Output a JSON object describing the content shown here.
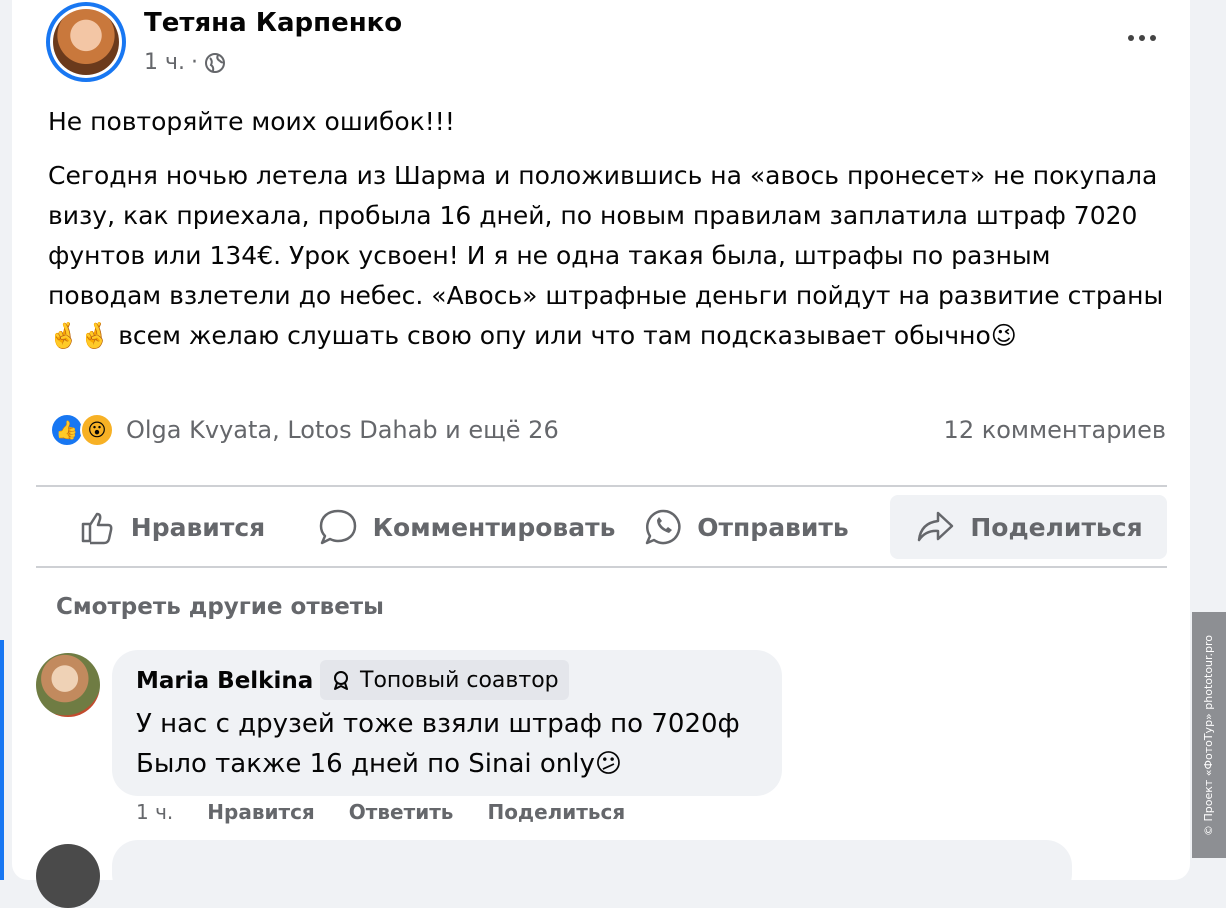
{
  "post": {
    "author": "Тетяна Карпенко",
    "time": "1 ч.",
    "meta_separator": "·",
    "paragraph1": "Не повторяйте моих ошибок!!!",
    "paragraph2": "Сегодня ночью летела из Шарма и положившись на «авось пронесет» не покупала визу, как приехала, пробыла 16 дней, по новым правилам заплатила штраф 7020 фунтов или 134€. Урок усвоен! И я не одна такая была, штрафы по разным поводам взлетели до небес. «Авось» штрафные деньги пойдут на развитие страны 🤞🤞 всем желаю слушать свою опу или что там подсказывает обычно😉",
    "reactions_text": "Olga Kvyata, Lotos Dahab и ещё 26",
    "comments_count": "12 комментариев"
  },
  "actions": {
    "like": "Нравится",
    "comment": "Комментировать",
    "send": "Отправить",
    "share": "Поделиться"
  },
  "comments": {
    "see_more": "Смотреть другие ответы",
    "first": {
      "author": "Maria Belkina",
      "badge": "Топовый соавтор",
      "line1": "У нас с друзей тоже взяли штраф по 7020ф",
      "line2": "Было также 16 дней по Sinai only😕",
      "time": "1 ч.",
      "like": "Нравится",
      "reply": "Ответить",
      "share": "Поделиться"
    }
  },
  "watermark": "© Проект «ФотоТур» phototour.pro",
  "icons": [
    "globe-icon",
    "more-icon",
    "like-icon",
    "comment-icon",
    "whatsapp-icon",
    "share-icon",
    "badge-icon"
  ],
  "colors": {
    "accent": "#1877f2",
    "muted": "#65676b",
    "bubble": "#f0f2f5"
  }
}
